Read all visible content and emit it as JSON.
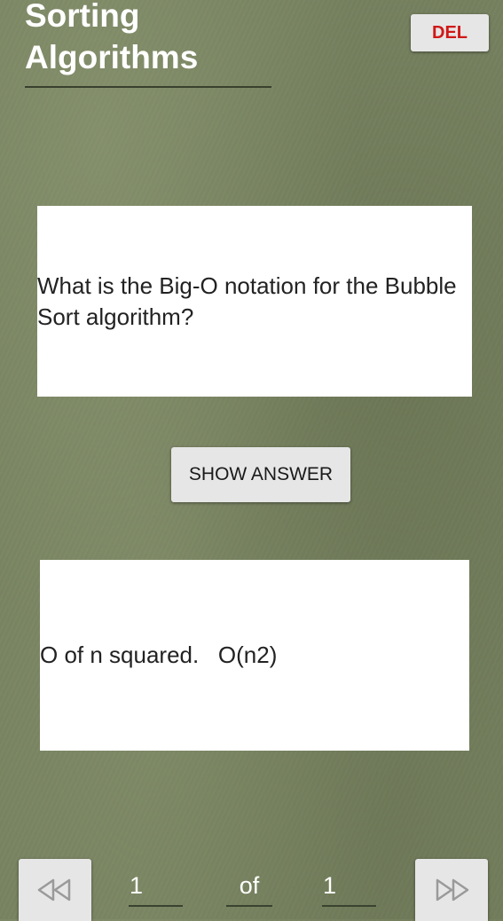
{
  "deck": {
    "title": "Sorting\nAlgorithms",
    "delete_label": "DEL"
  },
  "card": {
    "question": "What is the Big-O notation for the Bubble Sort algorithm?",
    "answer": "O of n squared.   O(n2)",
    "show_answer_label": "SHOW ANSWER"
  },
  "pager": {
    "current": "1",
    "of_label": "of",
    "total": "1"
  },
  "icons": {
    "prev": "rewind-icon",
    "next": "fast-forward-icon"
  },
  "colors": {
    "background": "#76815f",
    "card": "#ffffff",
    "button": "#e6e6e6",
    "delete_text": "#d01818",
    "title_text": "#ffffff"
  }
}
